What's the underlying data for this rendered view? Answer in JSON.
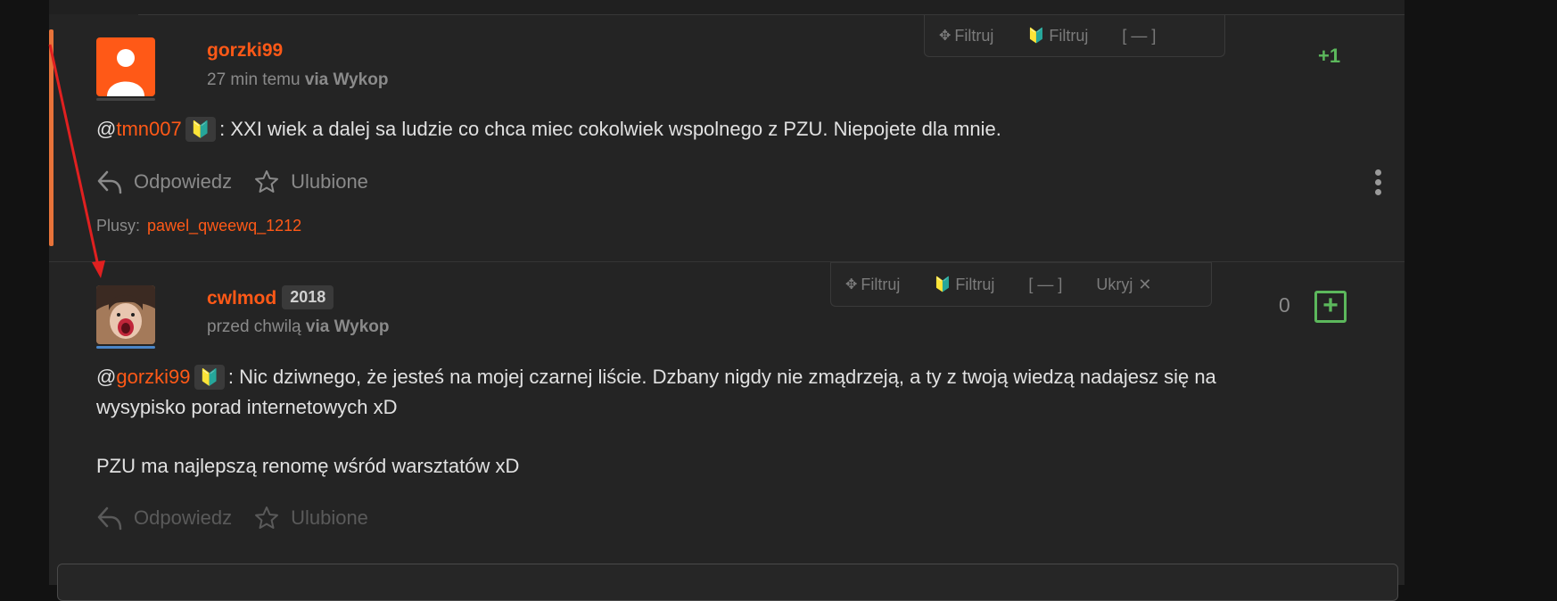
{
  "colors": {
    "accent": "#ff5917",
    "positive": "#5cb85c",
    "bar": "#e8733a"
  },
  "comments": [
    {
      "username": "gorzki99",
      "time": "27 min temu",
      "via": "via Wykop",
      "vote": "+1",
      "mention": "tmn007",
      "text": ": XXI wiek a dalej sa ludzie co chca miec cokolwiek wspolnego z PZU. Niepojete dla mnie.",
      "filters": [
        "Filtruj",
        "Filtruj",
        "[ — ]"
      ],
      "reply_label": "Odpowiedz",
      "fav_label": "Ulubione",
      "plusy_label": "Plusy:",
      "plusy_user": "pawel_qweewq_1212"
    },
    {
      "username": "cwlmod",
      "year_badge": "2018",
      "time": "przed chwilą",
      "via": "via Wykop",
      "vote": "0",
      "plus_button": "+",
      "mention": "gorzki99",
      "text_line1": ": Nic dziwnego, że jesteś na mojej czarnej liście. Dzbany nigdy nie zmądrzeją, a ty z twoją wiedzą nadajesz się na",
      "text_line2": "wysypisko porad internetowych xD",
      "text_para2": "PZU ma najlepszą renomę wśród warsztatów xD",
      "filters": [
        "Filtruj",
        "Filtruj",
        "[ — ]",
        "Ukryj"
      ],
      "reply_label": "Odpowiedz",
      "fav_label": "Ulubione"
    }
  ],
  "icons": {
    "leaf": "🔰",
    "filter": "✥",
    "close": "✕"
  }
}
